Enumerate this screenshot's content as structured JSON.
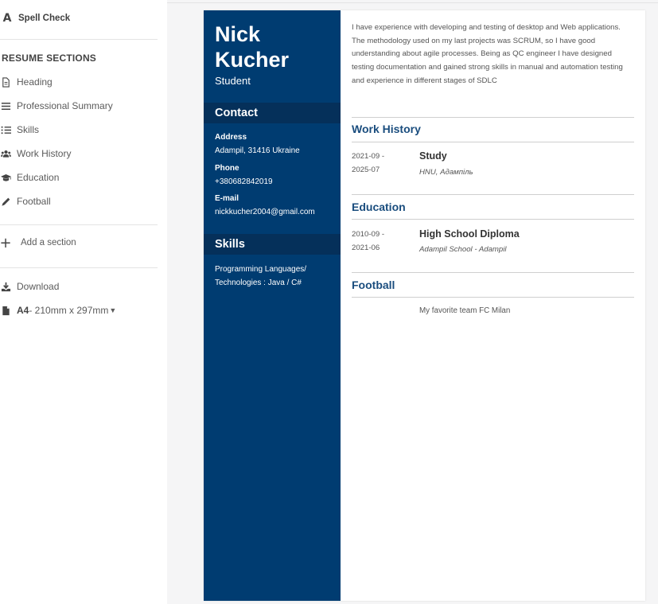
{
  "sidebar": {
    "spell_check_label": "Spell Check",
    "sections_title": "RESUME SECTIONS",
    "items": [
      {
        "label": "Heading",
        "icon": "document-icon"
      },
      {
        "label": "Professional Summary",
        "icon": "lines-icon"
      },
      {
        "label": "Skills",
        "icon": "list-icon"
      },
      {
        "label": "Work History",
        "icon": "users-icon"
      },
      {
        "label": "Education",
        "icon": "graduation-cap-icon"
      },
      {
        "label": "Football",
        "icon": "pencil-icon"
      }
    ],
    "add_section_label": "Add a section",
    "download_label": "Download",
    "page_size_name": "A4",
    "page_size_dims": " - 210mm x 297mm"
  },
  "resume": {
    "first_name": "Nick",
    "last_name": "Kucher",
    "role": "Student",
    "contact_heading": "Contact",
    "address_label": "Address",
    "address_value": "Adampil, 31416 Ukraine",
    "phone_label": "Phone",
    "phone_value": "+380682842019",
    "email_label": "E-mail",
    "email_value": "nickkucher2004@gmail.com",
    "skills_heading": "Skills",
    "skills_text": "Programming Languages/ Technologies : Java / C#",
    "summary": "I have experience with developing and testing of desktop and Web applications. The methodology used on my last projects was SCRUM, so I have good understanding about agile processes. Being as QC engineer I have designed testing documentation and gained strong skills in manual and automation testing and experience in different stages of SDLC",
    "work_heading": "Work History",
    "work": {
      "date_start": "2021-09 -",
      "date_end": "2025-07",
      "title": "Study",
      "subtitle": "HNU, Адампіль"
    },
    "education_heading": "Education",
    "education": {
      "date_start": "2010-09 -",
      "date_end": "2021-06",
      "title": "High School Diploma",
      "subtitle": "Adampil School - Adampil"
    },
    "football_heading": "Football",
    "football_text": "My favorite team FC Milan"
  },
  "colors": {
    "primary": "#003c71",
    "heading_bar": "#05305a",
    "section_heading": "#1a4d7e"
  }
}
